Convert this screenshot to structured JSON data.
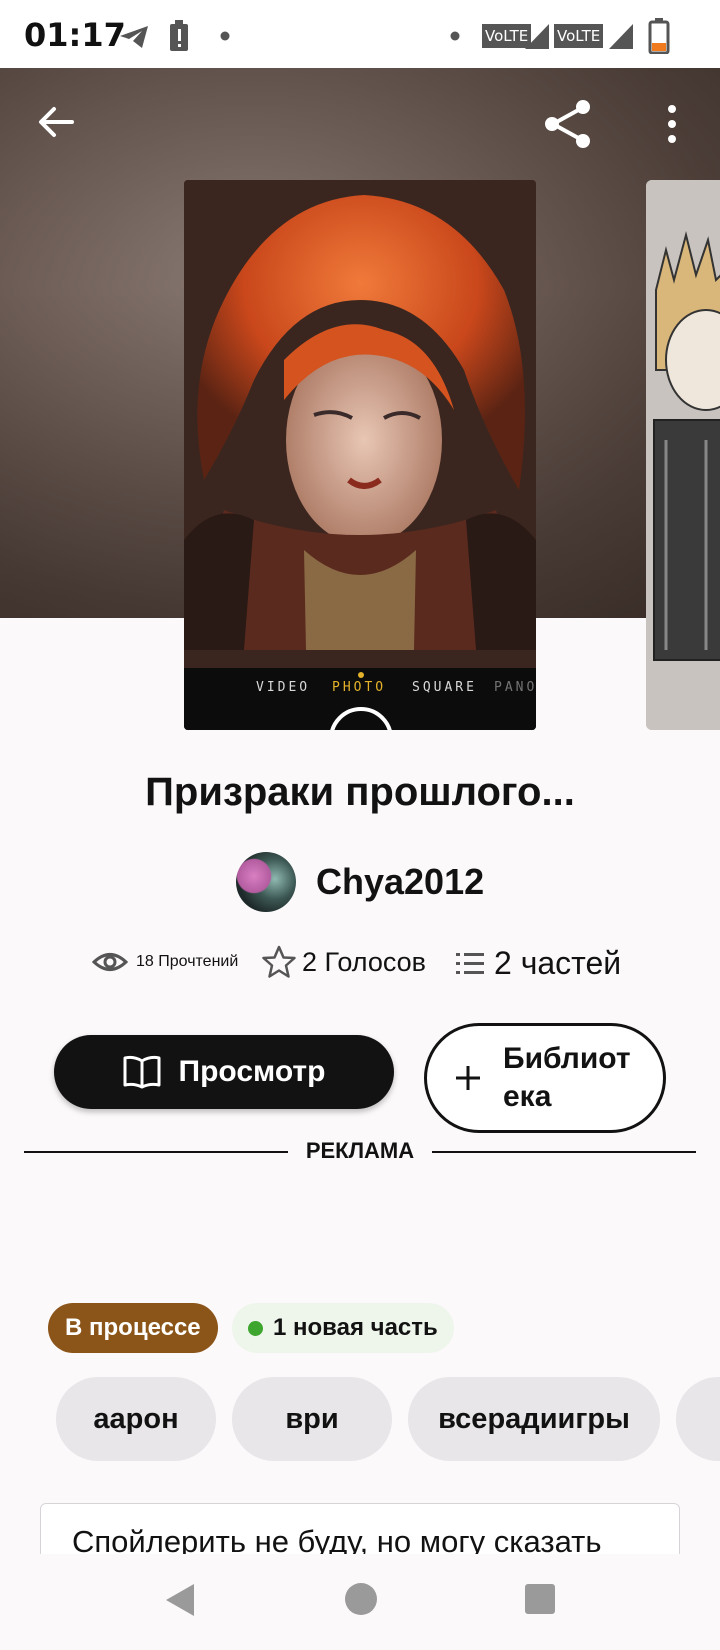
{
  "status_bar": {
    "time": "01:17",
    "network_1": "VoLTE",
    "network_2": "VoLTE"
  },
  "book": {
    "title": "Призраки прошлого...",
    "author": "Chya2012",
    "cover_camera_modes": [
      "VIDEO",
      "PHOTO",
      "SQUARE",
      "PANO"
    ],
    "stats": {
      "reads": "18 Прочтений",
      "votes": "2 Голосов",
      "parts": "2 частей"
    },
    "actions": {
      "read_label": "Просмотр",
      "library_label": "Библиотека"
    },
    "ad_label": "РЕКЛАМА",
    "status_tag": "В процессе",
    "new_part_tag": "1 новая часть",
    "tags": [
      "аарон",
      "ври",
      "всерадиигры"
    ],
    "description": "Спойлерить не буду, но могу сказать"
  },
  "colors": {
    "accent_dark": "#121212",
    "status_progress": "#8b5519",
    "new_dot": "#3ea52f"
  },
  "icons": [
    "back-arrow-icon",
    "share-icon",
    "more-vertical-icon",
    "eye-icon",
    "star-icon",
    "list-icon",
    "book-open-icon",
    "plus-icon",
    "nav-back-icon",
    "nav-home-icon",
    "nav-recents-icon"
  ]
}
